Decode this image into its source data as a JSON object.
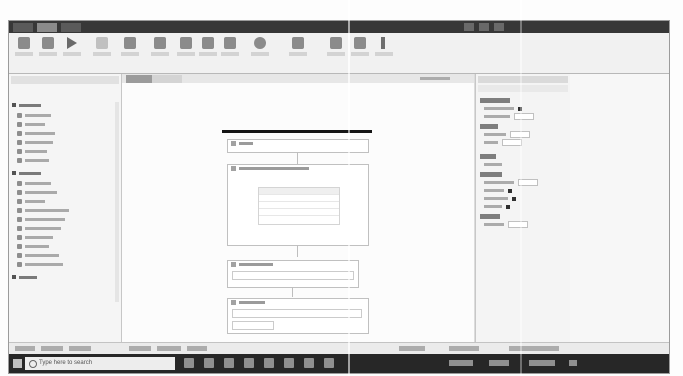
{
  "app": {
    "window_title": ""
  },
  "center": {
    "tabs": [
      ""
    ]
  },
  "taskbar": {
    "search_placeholder": "Type here to search"
  },
  "colors": {
    "taskbar": "#2b2b2b",
    "titlebar": "#3a3a3a",
    "ribbon": "#ececec",
    "designer": "#f6f6f6"
  },
  "icons": [
    "windows-start-icon",
    "search-icon",
    "play-icon",
    "save-icon",
    "gear-icon",
    "pin-icon"
  ]
}
